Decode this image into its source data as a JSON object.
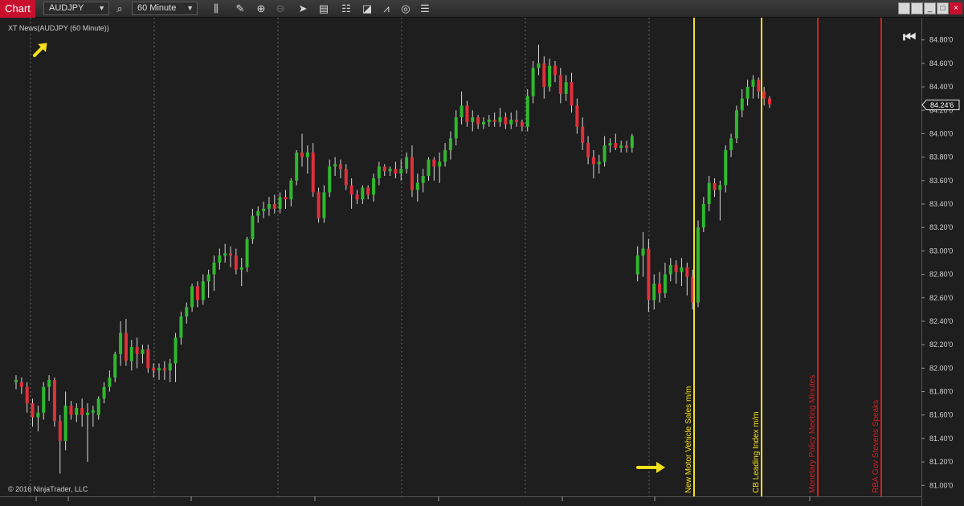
{
  "toolbar": {
    "chart_tab": "Chart",
    "instrument": "AUDJPY",
    "interval": "60 Minute",
    "icons": [
      "search-icon",
      "bar-type-icon",
      "pencil-icon",
      "zoom-in-icon",
      "zoom-out-icon",
      "cursor-icon",
      "properties-icon",
      "data-box-icon",
      "strategies-icon",
      "indicators-icon",
      "refresh-icon",
      "list-icon"
    ]
  },
  "indicator_label": "XT News(AUDJPY (60 Minute))",
  "copyright": "© 2016 NinjaTrader, LLC",
  "current_price": "84.24'6",
  "price_axis": {
    "labels": [
      "84.80'0",
      "84.60'0",
      "84.40'0",
      "84.20'0",
      "84.00'0",
      "83.80'0",
      "83.60'0",
      "83.40'0",
      "83.20'0",
      "83.00'0",
      "82.80'0",
      "82.60'0",
      "82.40'0",
      "82.20'0",
      "82.00'0",
      "81.80'0",
      "81.60'0",
      "81.40'0",
      "81.20'0",
      "81.00'0"
    ],
    "min": 80.906,
    "max": 84.99
  },
  "news_events": [
    {
      "label": "New Motor Vehicle Sales m/m",
      "color": "#f5e11b"
    },
    {
      "label": "CB Leading Index m/m",
      "color": "#f5e11b"
    },
    {
      "label": "Monetary Policy Meeting Minutes",
      "color": "#d42020"
    },
    {
      "label": "RBA Gov Stevens Speaks",
      "color": "#d42020"
    }
  ],
  "colors": {
    "up": "#2fb82f",
    "down": "#e0303a",
    "wick": "#d8d8d8",
    "grid": "#6a6a6a",
    "background": "#1e1e1e",
    "arrow": "#f5e11b"
  },
  "chart_data": {
    "type": "candlestick",
    "instrument": "AUDJPY",
    "interval": "60 Minute",
    "ylim": [
      80.906,
      84.99
    ],
    "candles": [
      {
        "o": 81.88,
        "h": 81.94,
        "l": 81.82,
        "c": 81.9
      },
      {
        "o": 81.88,
        "h": 81.92,
        "l": 81.78,
        "c": 81.84
      },
      {
        "o": 81.84,
        "h": 81.88,
        "l": 81.62,
        "c": 81.7
      },
      {
        "o": 81.7,
        "h": 81.74,
        "l": 81.5,
        "c": 81.58
      },
      {
        "o": 81.58,
        "h": 81.68,
        "l": 81.46,
        "c": 81.62
      },
      {
        "o": 81.62,
        "h": 81.88,
        "l": 81.56,
        "c": 81.84
      },
      {
        "o": 81.84,
        "h": 81.94,
        "l": 81.72,
        "c": 81.9
      },
      {
        "o": 81.9,
        "h": 81.92,
        "l": 81.5,
        "c": 81.55
      },
      {
        "o": 81.55,
        "h": 81.6,
        "l": 81.1,
        "c": 81.38
      },
      {
        "o": 81.38,
        "h": 81.8,
        "l": 81.3,
        "c": 81.68
      },
      {
        "o": 81.68,
        "h": 81.72,
        "l": 81.56,
        "c": 81.6
      },
      {
        "o": 81.6,
        "h": 81.7,
        "l": 81.54,
        "c": 81.66
      },
      {
        "o": 81.66,
        "h": 81.74,
        "l": 81.5,
        "c": 81.6
      },
      {
        "o": 81.6,
        "h": 81.7,
        "l": 81.2,
        "c": 81.62
      },
      {
        "o": 81.62,
        "h": 81.68,
        "l": 81.5,
        "c": 81.64
      },
      {
        "o": 81.6,
        "h": 81.76,
        "l": 81.56,
        "c": 81.74
      },
      {
        "o": 81.74,
        "h": 81.88,
        "l": 81.7,
        "c": 81.84
      },
      {
        "o": 81.84,
        "h": 81.98,
        "l": 81.8,
        "c": 81.92
      },
      {
        "o": 81.92,
        "h": 82.14,
        "l": 81.88,
        "c": 82.12
      },
      {
        "o": 82.12,
        "h": 82.4,
        "l": 82.02,
        "c": 82.3
      },
      {
        "o": 82.3,
        "h": 82.42,
        "l": 82.02,
        "c": 82.06
      },
      {
        "o": 82.06,
        "h": 82.24,
        "l": 81.98,
        "c": 82.18
      },
      {
        "o": 82.18,
        "h": 82.26,
        "l": 82.0,
        "c": 82.12
      },
      {
        "o": 82.12,
        "h": 82.2,
        "l": 82.04,
        "c": 82.16
      },
      {
        "o": 82.16,
        "h": 82.2,
        "l": 81.96,
        "c": 82.0
      },
      {
        "o": 82.0,
        "h": 82.04,
        "l": 81.92,
        "c": 81.98
      },
      {
        "o": 81.98,
        "h": 82.04,
        "l": 81.9,
        "c": 82.0
      },
      {
        "o": 82.0,
        "h": 82.06,
        "l": 81.9,
        "c": 81.98
      },
      {
        "o": 81.98,
        "h": 82.08,
        "l": 81.88,
        "c": 82.04
      },
      {
        "o": 82.04,
        "h": 82.3,
        "l": 81.88,
        "c": 82.26
      },
      {
        "o": 82.26,
        "h": 82.48,
        "l": 82.2,
        "c": 82.44
      },
      {
        "o": 82.44,
        "h": 82.56,
        "l": 82.38,
        "c": 82.52
      },
      {
        "o": 82.52,
        "h": 82.72,
        "l": 82.48,
        "c": 82.7
      },
      {
        "o": 82.7,
        "h": 82.74,
        "l": 82.52,
        "c": 82.58
      },
      {
        "o": 82.58,
        "h": 82.8,
        "l": 82.54,
        "c": 82.74
      },
      {
        "o": 82.74,
        "h": 82.84,
        "l": 82.6,
        "c": 82.8
      },
      {
        "o": 82.8,
        "h": 82.96,
        "l": 82.66,
        "c": 82.9
      },
      {
        "o": 82.9,
        "h": 83.02,
        "l": 82.84,
        "c": 82.96
      },
      {
        "o": 82.96,
        "h": 83.06,
        "l": 82.9,
        "c": 82.98
      },
      {
        "o": 82.98,
        "h": 83.04,
        "l": 82.86,
        "c": 82.96
      },
      {
        "o": 82.96,
        "h": 83.02,
        "l": 82.8,
        "c": 82.84
      },
      {
        "o": 82.84,
        "h": 82.94,
        "l": 82.7,
        "c": 82.86
      },
      {
        "o": 82.86,
        "h": 83.12,
        "l": 82.82,
        "c": 83.1
      },
      {
        "o": 83.1,
        "h": 83.36,
        "l": 83.06,
        "c": 83.3
      },
      {
        "o": 83.3,
        "h": 83.38,
        "l": 83.24,
        "c": 83.34
      },
      {
        "o": 83.34,
        "h": 83.42,
        "l": 83.28,
        "c": 83.36
      },
      {
        "o": 83.36,
        "h": 83.46,
        "l": 83.3,
        "c": 83.4
      },
      {
        "o": 83.4,
        "h": 83.48,
        "l": 83.32,
        "c": 83.36
      },
      {
        "o": 83.36,
        "h": 83.5,
        "l": 83.32,
        "c": 83.46
      },
      {
        "o": 83.46,
        "h": 83.52,
        "l": 83.36,
        "c": 83.44
      },
      {
        "o": 83.44,
        "h": 83.62,
        "l": 83.38,
        "c": 83.6
      },
      {
        "o": 83.6,
        "h": 83.86,
        "l": 83.56,
        "c": 83.84
      },
      {
        "o": 83.84,
        "h": 84.0,
        "l": 83.72,
        "c": 83.8
      },
      {
        "o": 83.8,
        "h": 83.9,
        "l": 83.66,
        "c": 83.84
      },
      {
        "o": 83.84,
        "h": 83.92,
        "l": 83.46,
        "c": 83.5
      },
      {
        "o": 83.5,
        "h": 83.54,
        "l": 83.24,
        "c": 83.28
      },
      {
        "o": 83.28,
        "h": 83.56,
        "l": 83.24,
        "c": 83.5
      },
      {
        "o": 83.5,
        "h": 83.78,
        "l": 83.46,
        "c": 83.72
      },
      {
        "o": 83.72,
        "h": 83.8,
        "l": 83.64,
        "c": 83.74
      },
      {
        "o": 83.74,
        "h": 83.78,
        "l": 83.62,
        "c": 83.7
      },
      {
        "o": 83.7,
        "h": 83.74,
        "l": 83.52,
        "c": 83.56
      },
      {
        "o": 83.56,
        "h": 83.62,
        "l": 83.36,
        "c": 83.48
      },
      {
        "o": 83.48,
        "h": 83.52,
        "l": 83.4,
        "c": 83.44
      },
      {
        "o": 83.44,
        "h": 83.56,
        "l": 83.4,
        "c": 83.54
      },
      {
        "o": 83.54,
        "h": 83.56,
        "l": 83.44,
        "c": 83.48
      },
      {
        "o": 83.48,
        "h": 83.66,
        "l": 83.42,
        "c": 83.62
      },
      {
        "o": 83.62,
        "h": 83.76,
        "l": 83.56,
        "c": 83.72
      },
      {
        "o": 83.72,
        "h": 83.74,
        "l": 83.64,
        "c": 83.68
      },
      {
        "o": 83.68,
        "h": 83.72,
        "l": 83.64,
        "c": 83.7
      },
      {
        "o": 83.7,
        "h": 83.76,
        "l": 83.62,
        "c": 83.66
      },
      {
        "o": 83.66,
        "h": 83.78,
        "l": 83.6,
        "c": 83.7
      },
      {
        "o": 83.7,
        "h": 83.84,
        "l": 83.66,
        "c": 83.8
      },
      {
        "o": 83.8,
        "h": 83.9,
        "l": 83.46,
        "c": 83.52
      },
      {
        "o": 83.52,
        "h": 83.66,
        "l": 83.42,
        "c": 83.58
      },
      {
        "o": 83.58,
        "h": 83.7,
        "l": 83.5,
        "c": 83.64
      },
      {
        "o": 83.64,
        "h": 83.8,
        "l": 83.6,
        "c": 83.78
      },
      {
        "o": 83.78,
        "h": 83.8,
        "l": 83.6,
        "c": 83.72
      },
      {
        "o": 83.72,
        "h": 83.84,
        "l": 83.58,
        "c": 83.76
      },
      {
        "o": 83.76,
        "h": 83.92,
        "l": 83.72,
        "c": 83.86
      },
      {
        "o": 83.86,
        "h": 84.02,
        "l": 83.78,
        "c": 83.96
      },
      {
        "o": 83.96,
        "h": 84.2,
        "l": 83.9,
        "c": 84.14
      },
      {
        "o": 84.14,
        "h": 84.36,
        "l": 84.08,
        "c": 84.24
      },
      {
        "o": 84.24,
        "h": 84.28,
        "l": 84.06,
        "c": 84.1
      },
      {
        "o": 84.1,
        "h": 84.2,
        "l": 84.02,
        "c": 84.14
      },
      {
        "o": 84.14,
        "h": 84.16,
        "l": 84.04,
        "c": 84.08
      },
      {
        "o": 84.08,
        "h": 84.14,
        "l": 84.04,
        "c": 84.1
      },
      {
        "o": 84.1,
        "h": 84.16,
        "l": 84.06,
        "c": 84.12
      },
      {
        "o": 84.12,
        "h": 84.18,
        "l": 84.06,
        "c": 84.1
      },
      {
        "o": 84.1,
        "h": 84.22,
        "l": 84.06,
        "c": 84.14
      },
      {
        "o": 84.14,
        "h": 84.18,
        "l": 84.04,
        "c": 84.08
      },
      {
        "o": 84.08,
        "h": 84.18,
        "l": 84.04,
        "c": 84.12
      },
      {
        "o": 84.12,
        "h": 84.2,
        "l": 84.06,
        "c": 84.1
      },
      {
        "o": 84.1,
        "h": 84.12,
        "l": 84.02,
        "c": 84.06
      },
      {
        "o": 84.06,
        "h": 84.38,
        "l": 84.02,
        "c": 84.32
      },
      {
        "o": 84.32,
        "h": 84.62,
        "l": 84.26,
        "c": 84.56
      },
      {
        "o": 84.56,
        "h": 84.76,
        "l": 84.5,
        "c": 84.6
      },
      {
        "o": 84.6,
        "h": 84.66,
        "l": 84.3,
        "c": 84.4
      },
      {
        "o": 84.4,
        "h": 84.64,
        "l": 84.36,
        "c": 84.58
      },
      {
        "o": 84.58,
        "h": 84.62,
        "l": 84.44,
        "c": 84.5
      },
      {
        "o": 84.5,
        "h": 84.56,
        "l": 84.26,
        "c": 84.34
      },
      {
        "o": 84.34,
        "h": 84.5,
        "l": 84.28,
        "c": 84.44
      },
      {
        "o": 84.44,
        "h": 84.52,
        "l": 84.18,
        "c": 84.24
      },
      {
        "o": 84.24,
        "h": 84.3,
        "l": 84.0,
        "c": 84.06
      },
      {
        "o": 84.06,
        "h": 84.14,
        "l": 83.86,
        "c": 83.92
      },
      {
        "o": 83.92,
        "h": 83.98,
        "l": 83.74,
        "c": 83.8
      },
      {
        "o": 83.8,
        "h": 83.86,
        "l": 83.62,
        "c": 83.74
      },
      {
        "o": 83.74,
        "h": 83.82,
        "l": 83.66,
        "c": 83.76
      },
      {
        "o": 83.76,
        "h": 83.98,
        "l": 83.72,
        "c": 83.9
      },
      {
        "o": 83.9,
        "h": 83.96,
        "l": 83.84,
        "c": 83.92
      },
      {
        "o": 83.92,
        "h": 84.0,
        "l": 83.86,
        "c": 83.88
      },
      {
        "o": 83.88,
        "h": 83.94,
        "l": 83.84,
        "c": 83.9
      },
      {
        "o": 83.9,
        "h": 83.94,
        "l": 83.84,
        "c": 83.88
      },
      {
        "o": 83.88,
        "h": 84.0,
        "l": 83.84,
        "c": 83.98
      },
      {
        "o": 82.8,
        "h": 83.04,
        "l": 82.74,
        "c": 82.96
      },
      {
        "o": 82.96,
        "h": 83.16,
        "l": 82.78,
        "c": 83.02
      },
      {
        "o": 83.02,
        "h": 83.1,
        "l": 82.48,
        "c": 82.58
      },
      {
        "o": 82.58,
        "h": 82.8,
        "l": 82.5,
        "c": 82.72
      },
      {
        "o": 82.72,
        "h": 82.82,
        "l": 82.56,
        "c": 82.64
      },
      {
        "o": 82.64,
        "h": 82.9,
        "l": 82.6,
        "c": 82.8
      },
      {
        "o": 82.8,
        "h": 82.94,
        "l": 82.74,
        "c": 82.88
      },
      {
        "o": 82.88,
        "h": 82.92,
        "l": 82.72,
        "c": 82.82
      },
      {
        "o": 82.82,
        "h": 82.94,
        "l": 82.7,
        "c": 82.86
      },
      {
        "o": 82.86,
        "h": 82.9,
        "l": 82.62,
        "c": 82.78
      },
      {
        "o": 82.78,
        "h": 82.84,
        "l": 82.5,
        "c": 82.56
      },
      {
        "o": 82.56,
        "h": 83.26,
        "l": 82.52,
        "c": 83.2
      },
      {
        "o": 83.2,
        "h": 83.46,
        "l": 83.16,
        "c": 83.4
      },
      {
        "o": 83.4,
        "h": 83.64,
        "l": 83.34,
        "c": 83.58
      },
      {
        "o": 83.58,
        "h": 83.62,
        "l": 83.46,
        "c": 83.52
      },
      {
        "o": 83.52,
        "h": 83.6,
        "l": 83.26,
        "c": 83.56
      },
      {
        "o": 83.56,
        "h": 83.9,
        "l": 83.5,
        "c": 83.86
      },
      {
        "o": 83.86,
        "h": 84.0,
        "l": 83.8,
        "c": 83.96
      },
      {
        "o": 83.96,
        "h": 84.24,
        "l": 83.92,
        "c": 84.2
      },
      {
        "o": 84.2,
        "h": 84.38,
        "l": 84.14,
        "c": 84.3
      },
      {
        "o": 84.3,
        "h": 84.46,
        "l": 84.24,
        "c": 84.4
      },
      {
        "o": 84.4,
        "h": 84.5,
        "l": 84.3,
        "c": 84.46
      },
      {
        "o": 84.46,
        "h": 84.48,
        "l": 84.3,
        "c": 84.36
      },
      {
        "o": 84.36,
        "h": 84.4,
        "l": 84.24,
        "c": 84.3
      },
      {
        "o": 84.3,
        "h": 84.32,
        "l": 84.22,
        "c": 84.25
      }
    ]
  }
}
